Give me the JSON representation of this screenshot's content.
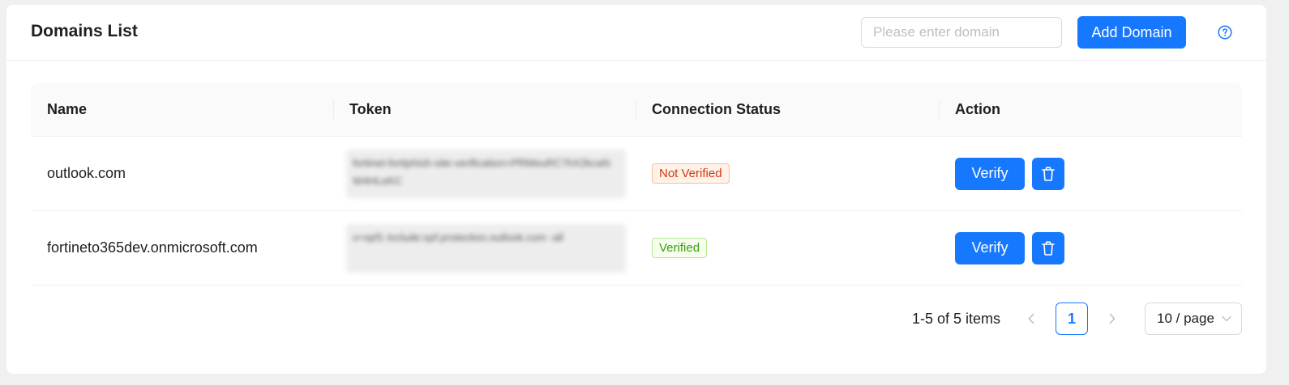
{
  "header": {
    "title": "Domains List",
    "search_placeholder": "Please enter domain",
    "add_button": "Add Domain",
    "help_icon": "question-circle-icon"
  },
  "table": {
    "columns": [
      "Name",
      "Token",
      "Connection Status",
      "Action"
    ],
    "rows": [
      {
        "name": "outlook.com",
        "token": "fortinet-fortiphish-site-verification=PRMeuRC7hX2kcaNW4HLeKC",
        "status": "Not Verified",
        "verify_label": "Verify"
      },
      {
        "name": "fortineto365dev.onmicrosoft.com",
        "token": "v=spf1 include:spf.protection.outlook.com -all",
        "status": "Verified",
        "verify_label": "Verify"
      }
    ]
  },
  "pagination": {
    "total_text": "1-5 of 5 items",
    "current_page": "1",
    "page_size": "10 / page"
  },
  "colors": {
    "primary": "#1677ff",
    "not_verified": "#d4380d",
    "verified": "#389e0d"
  }
}
